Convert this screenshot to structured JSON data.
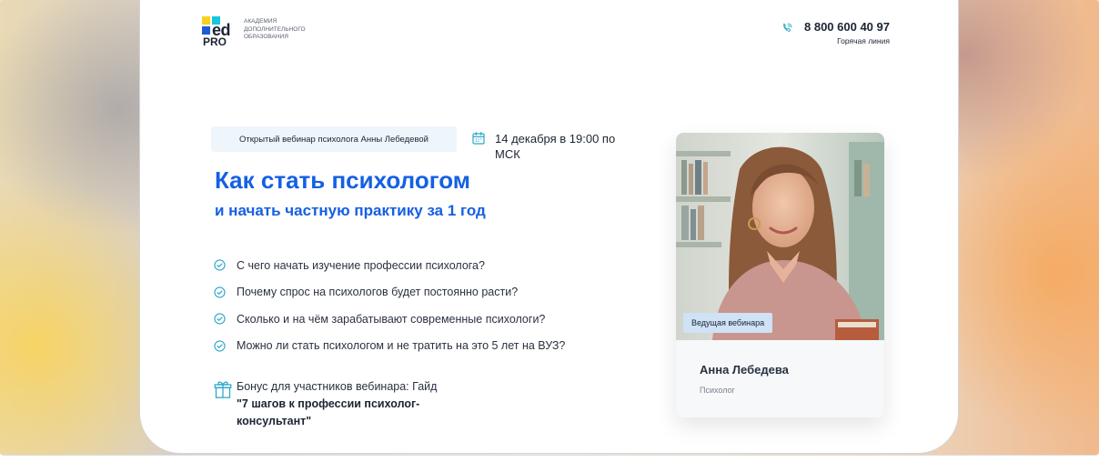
{
  "header": {
    "logo": {
      "mark_top": "ed",
      "mark_bottom": "PRO",
      "lines": [
        "АКАДЕМИЯ",
        "ДОПОЛНИТЕЛЬНОГО",
        "ОБРАЗОВАНИЯ"
      ]
    },
    "phone": {
      "number": "8 800 600 40 97",
      "label": "Горячая линия",
      "icon": "phone-icon"
    }
  },
  "hero": {
    "tag": "Открытый вебинар психолога Анны Лебедевой",
    "date": "14 декабря в 19:00 по МСК",
    "title": "Как стать психологом",
    "subtitle": "и начать частную практику за 1 год",
    "points": [
      "С чего начать изучение профессии психолога?",
      "Почему спрос на психологов будет постоянно расти?",
      "Сколько и на чём зарабатывают современные психологи?",
      "Можно ли стать психологом и не тратить на это 5 лет на ВУЗ?"
    ],
    "bonus_intro": "Бонус для участников вебинара: Гайд",
    "bonus_title": "\"7 шагов к профессии психолог-консультант\""
  },
  "speaker": {
    "badge": "Ведущая вебинара",
    "name": "Анна Лебедева",
    "role": "Психолог"
  },
  "colors": {
    "accent": "#1560e3",
    "check": "#2aa7c9",
    "badge_bg": "#cfe2f6",
    "tag_bg": "#eef5fb"
  }
}
